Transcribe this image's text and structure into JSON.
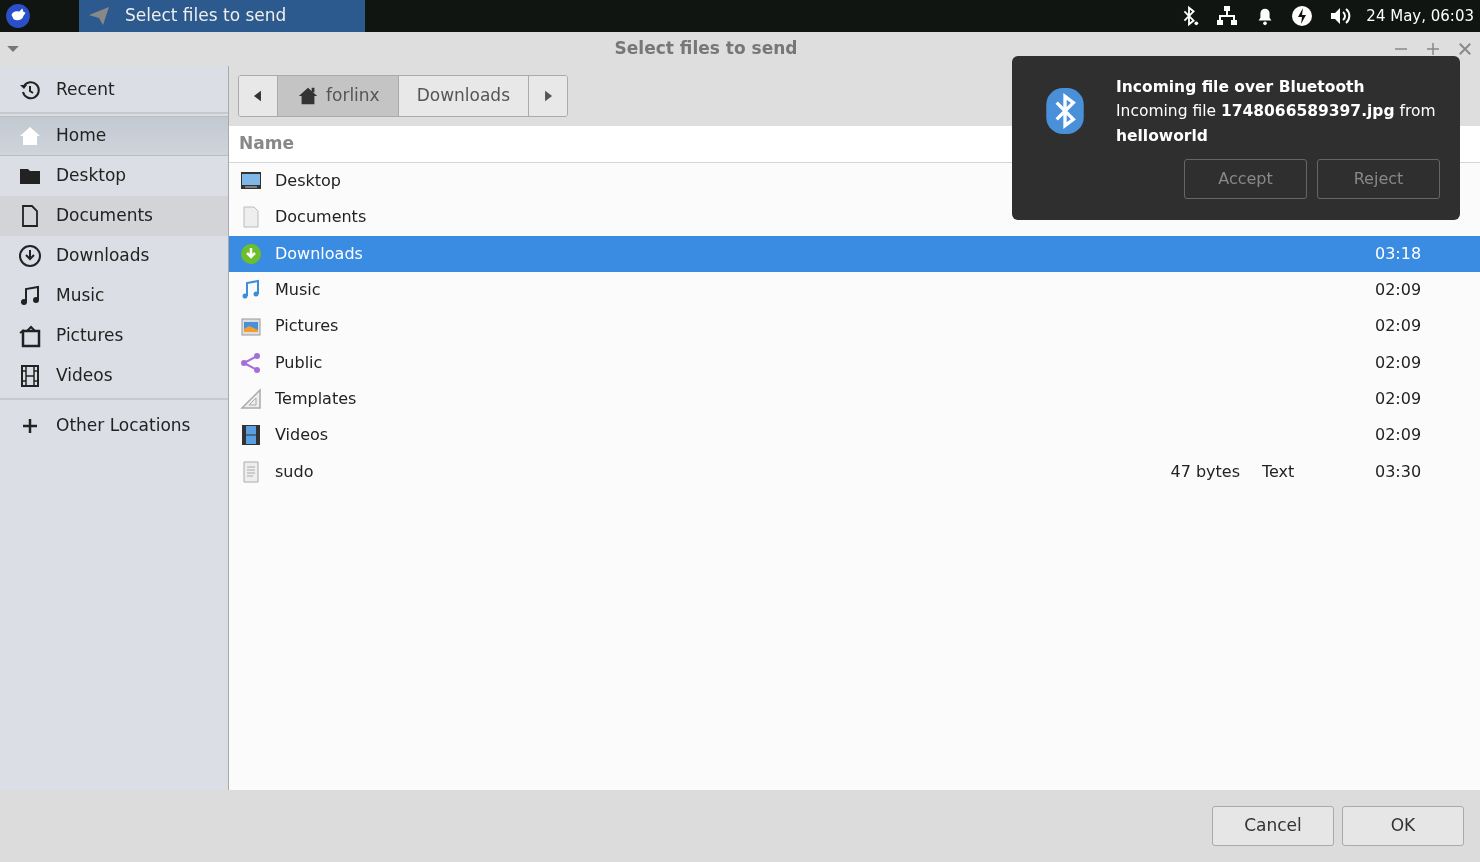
{
  "taskbar": {
    "task": {
      "label": "Select files to send",
      "active": true
    },
    "clock": "24 May, 06:03"
  },
  "window": {
    "title": "Select files to send"
  },
  "sidebar": {
    "sections": [
      {
        "items": [
          {
            "label": "Recent",
            "selected": false,
            "hovered": false
          }
        ]
      },
      {
        "items": [
          {
            "label": "Home",
            "selected": true,
            "hovered": false
          },
          {
            "label": "Desktop",
            "selected": false,
            "hovered": false
          },
          {
            "label": "Documents",
            "selected": false,
            "hovered": true
          },
          {
            "label": "Downloads",
            "selected": false,
            "hovered": false
          },
          {
            "label": "Music",
            "selected": false,
            "hovered": false
          },
          {
            "label": "Pictures",
            "selected": false,
            "hovered": false
          },
          {
            "label": "Videos",
            "selected": false,
            "hovered": false
          }
        ]
      },
      {
        "items": [
          {
            "label": "Other Locations",
            "selected": false,
            "hovered": false
          }
        ]
      }
    ]
  },
  "path_bar": {
    "segments": [
      {
        "label": "forlinx",
        "selected": true
      },
      {
        "label": "Downloads",
        "selected": false
      }
    ]
  },
  "table": {
    "columns": [
      "Name"
    ],
    "rows": [
      {
        "name": "Desktop",
        "selected": false
      },
      {
        "name": "Documents",
        "selected": false
      },
      {
        "name": "Downloads",
        "modified": "03:18",
        "selected": true
      },
      {
        "name": "Music",
        "modified": "02:09",
        "selected": false
      },
      {
        "name": "Pictures",
        "modified": "02:09",
        "selected": false
      },
      {
        "name": "Public",
        "modified": "02:09",
        "selected": false
      },
      {
        "name": "Templates",
        "modified": "02:09",
        "selected": false
      },
      {
        "name": "Videos",
        "modified": "02:09",
        "selected": false
      },
      {
        "name": "sudo",
        "size": "47 bytes",
        "type": "Text",
        "modified": "03:30",
        "selected": false
      }
    ]
  },
  "notification": {
    "title": "Incoming file over Bluetooth",
    "body": "Incoming file **1748066589397.jpg** from **helloworld**",
    "buttons": [
      "Accept",
      "Reject"
    ]
  },
  "buttons": [
    "Cancel",
    "OK"
  ]
}
